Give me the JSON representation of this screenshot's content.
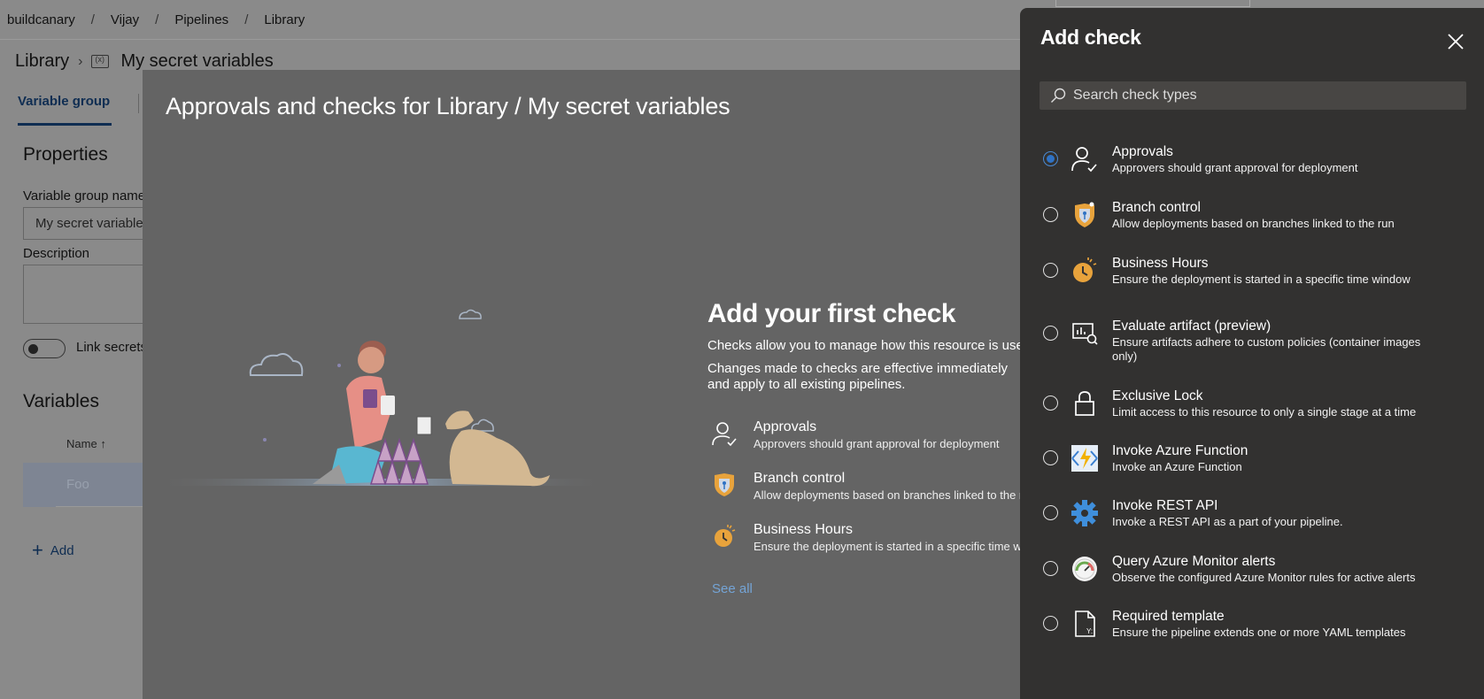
{
  "breadcrumb": [
    "buildcanary",
    "Vijay",
    "Pipelines",
    "Library"
  ],
  "page": {
    "section": "Library",
    "group_name": "My secret variables",
    "tab_variable_group": "Variable group",
    "properties_heading": "Properties",
    "vg_name_label": "Variable group name",
    "vg_name_value": "My secret variables",
    "description_label": "Description",
    "link_secrets_label": "Link secrets from an Azure key vault as variables",
    "variables_heading": "Variables",
    "name_column": "Name",
    "sort_icon": "arrow-up-icon",
    "row_foo": "Foo",
    "add_label": "Add"
  },
  "modal": {
    "title": "Approvals and checks for Library / My secret variables",
    "heading": "Add your first check",
    "p1": "Checks allow you to manage how this resource is used",
    "p2": "Changes made to checks are effective immediately and apply to all existing pipelines.",
    "items": [
      {
        "title": "Approvals",
        "desc": "Approvers should grant approval for deployment",
        "icon": "approvals-icon"
      },
      {
        "title": "Branch control",
        "desc": "Allow deployments based on branches linked to the run",
        "icon": "branch-control-icon"
      },
      {
        "title": "Business Hours",
        "desc": "Ensure the deployment is started in a specific time window",
        "icon": "business-hours-icon"
      }
    ],
    "see_all": "See all"
  },
  "panel": {
    "title": "Add check",
    "search_placeholder": "Search check types",
    "checks": [
      {
        "title": "Approvals",
        "desc": "Approvers should grant approval for deployment",
        "selected": true,
        "icon": "approvals-icon"
      },
      {
        "title": "Branch control",
        "desc": "Allow deployments based on branches linked to the run",
        "selected": false,
        "icon": "branch-control-icon"
      },
      {
        "title": "Business Hours",
        "desc": "Ensure the deployment is started in a specific time window",
        "selected": false,
        "icon": "business-hours-icon"
      },
      {
        "title": "Evaluate artifact (preview)",
        "desc": "Ensure artifacts adhere to custom policies (container images only)",
        "selected": false,
        "icon": "evaluate-artifact-icon"
      },
      {
        "title": "Exclusive Lock",
        "desc": "Limit access to this resource to only a single stage at a time",
        "selected": false,
        "icon": "lock-icon"
      },
      {
        "title": "Invoke Azure Function",
        "desc": "Invoke an Azure Function",
        "selected": false,
        "icon": "azure-function-icon"
      },
      {
        "title": "Invoke REST API",
        "desc": "Invoke a REST API as a part of your pipeline.",
        "selected": false,
        "icon": "gear-icon"
      },
      {
        "title": "Query Azure Monitor alerts",
        "desc": "Observe the configured Azure Monitor rules for active alerts",
        "selected": false,
        "icon": "azure-monitor-icon"
      },
      {
        "title": "Required template",
        "desc": "Ensure the pipeline extends one or more YAML templates",
        "selected": false,
        "icon": "yaml-template-icon"
      }
    ]
  },
  "colors": {
    "panel_bg": "#323130",
    "accent": "#2f72c4",
    "link": "#74a4d6",
    "clock": "#e8a33c"
  }
}
